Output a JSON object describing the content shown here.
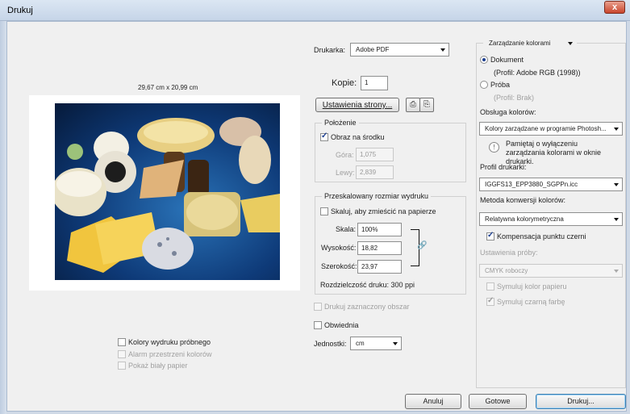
{
  "window": {
    "title": "Drukuj",
    "close_glyph": "x"
  },
  "preview": {
    "paper_size": "29,67 cm x 20,99 cm"
  },
  "printer": {
    "label": "Drukarka:",
    "value": "Adobe PDF"
  },
  "copies": {
    "label": "Kopie:",
    "value": "1"
  },
  "page_setup": {
    "label": "Ustawienia strony..."
  },
  "position": {
    "title": "Położenie",
    "center_label": "Obraz na środku",
    "center_checked": true,
    "top_label": "Góra:",
    "top_value": "1,075",
    "left_label": "Lewy:",
    "left_value": "2,839"
  },
  "scaled": {
    "title": "Przeskalowany rozmiar wydruku",
    "fit_label": "Skaluj, aby zmieścić na papierze",
    "scale_label": "Skala:",
    "scale_value": "100%",
    "height_label": "Wysokość:",
    "height_value": "18,82",
    "width_label": "Szerokość:",
    "width_value": "23,97",
    "resolution": "Rozdzielczość druku: 300 ppi"
  },
  "print_selected": "Drukuj zaznaczony obszar",
  "bounding_box": "Obwiednia",
  "units": {
    "label": "Jednostki:",
    "value": "cm"
  },
  "proof_options": {
    "proof_colors": "Kolory wydruku próbnego",
    "gamut_warning": "Alarm przestrzeni kolorów",
    "paper_white": "Pokaż biały papier"
  },
  "color_management": {
    "title": "Zarządzanie kolorami",
    "document_label": "Dokument",
    "document_profile": "(Profil: Adobe RGB (1998))",
    "proof_label": "Próba",
    "proof_profile": "(Profil: Brak)",
    "color_handling_label": "Obsługa kolorów:",
    "color_handling_value": "Kolory zarządzane w programie Photosh...",
    "note": "Pamiętaj o wyłączeniu zarządzania kolorami w oknie drukarki.",
    "printer_profile_label": "Profil drukarki:",
    "printer_profile_value": "IGGFS13_EPP3880_SGPPn.icc",
    "rendering_label": "Metoda konwersji kolorów:",
    "rendering_value": "Relatywna kolorymetryczna",
    "bpc_label": "Kompensacja punktu czerni",
    "proof_setup_label": "Ustawienia próby:",
    "proof_setup_value": "CMYK roboczy",
    "simulate_paper": "Symuluj kolor papieru",
    "simulate_ink": "Symuluj czarną farbę"
  },
  "buttons": {
    "cancel": "Anuluj",
    "done": "Gotowe",
    "print": "Drukuj..."
  },
  "colors": {
    "titlebar": "#c6d5e8",
    "close": "#c9452c",
    "accent": "#1a3d8f",
    "face": "#f0f0f0"
  }
}
